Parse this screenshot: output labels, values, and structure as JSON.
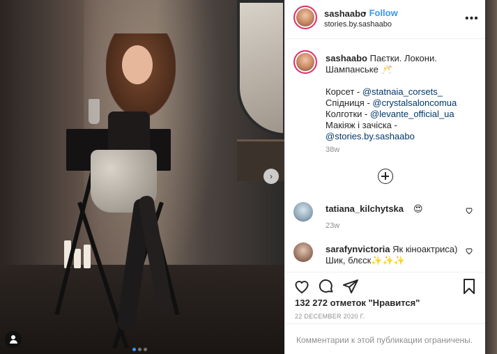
{
  "post": {
    "username": "sashaabo",
    "follow_separator": "•",
    "follow_label": "Follow",
    "location": "stories.by.sashaabo",
    "more_icon": "•••",
    "next_icon": "›"
  },
  "caption": {
    "username": "sashaabo",
    "line1": "Паєтки. Локони. Шампанське 🥂",
    "items": [
      {
        "label": "Корсет - ",
        "link": "@statnaia_corsets_"
      },
      {
        "label": "Спідниця - ",
        "link": "@crystalsaloncomua"
      },
      {
        "label": "Колготки - ",
        "link": "@levante_official_ua"
      },
      {
        "label": "Макіяж і зачіска - ",
        "link": "@stories.by.sashaabo"
      }
    ],
    "time": "38w"
  },
  "comments": [
    {
      "username": "tatiana_kilchytska",
      "text": "😍",
      "time": "23w"
    },
    {
      "username": "sarafynvictoria",
      "text": "Як кіноактриса) Шик, блєск✨✨✨",
      "time": ""
    }
  ],
  "likes": "132 272 отметок \"Нравится\"",
  "date": "22 DECEMBER 2020 Г.",
  "comments_disabled": "Комментарии к этой публикации ограничены.",
  "icons": [
    "heart-icon",
    "comment-icon",
    "share-icon",
    "bookmark-icon",
    "plus-circle-icon",
    "more-icon",
    "user-tag-icon"
  ],
  "colors": {
    "accent": "#3897f0",
    "link": "#00376b",
    "muted": "#8e8e8e",
    "text": "#262626"
  }
}
